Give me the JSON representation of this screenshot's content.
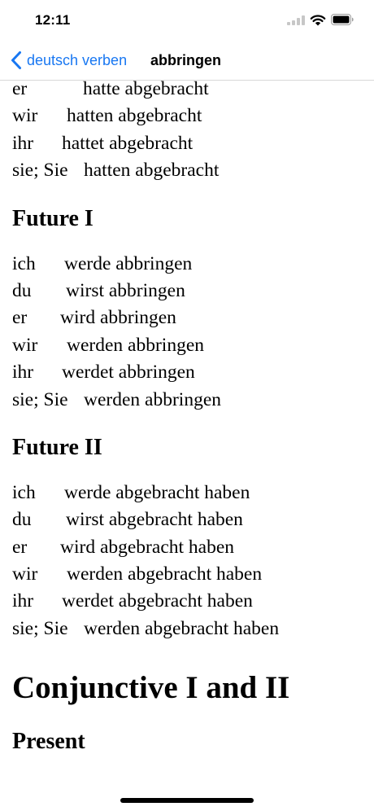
{
  "status_bar": {
    "time": "12:11"
  },
  "nav": {
    "back_label": "deutsch verben",
    "title": "abbringen"
  },
  "sections": {
    "pluperfect_tail": [
      {
        "pronoun": "er",
        "verb": "hatte abgebracht"
      },
      {
        "pronoun": "wir",
        "verb": "hatten abgebracht"
      },
      {
        "pronoun": "ihr",
        "verb": "hattet abgebracht"
      },
      {
        "pronoun": "sie; Sie",
        "verb": "hatten abgebracht"
      }
    ],
    "future1": {
      "heading": "Future I",
      "lines": [
        {
          "pronoun": "ich",
          "verb": "werde abbringen"
        },
        {
          "pronoun": "du",
          "verb": "wirst abbringen"
        },
        {
          "pronoun": "er",
          "verb": "wird abbringen"
        },
        {
          "pronoun": "wir",
          "verb": "werden abbringen"
        },
        {
          "pronoun": "ihr",
          "verb": "werdet abbringen"
        },
        {
          "pronoun": "sie; Sie",
          "verb": "werden abbringen"
        }
      ]
    },
    "future2": {
      "heading": "Future II",
      "lines": [
        {
          "pronoun": "ich",
          "verb": "werde abgebracht haben"
        },
        {
          "pronoun": "du",
          "verb": "wirst abgebracht haben"
        },
        {
          "pronoun": "er",
          "verb": "wird abgebracht haben"
        },
        {
          "pronoun": "wir",
          "verb": "werden abgebracht haben"
        },
        {
          "pronoun": "ihr",
          "verb": "werdet abgebracht haben"
        },
        {
          "pronoun": "sie; Sie",
          "verb": "werden abgebracht haben"
        }
      ]
    },
    "conjunctive_heading": "Conjunctive I and II",
    "present_heading": "Present"
  }
}
